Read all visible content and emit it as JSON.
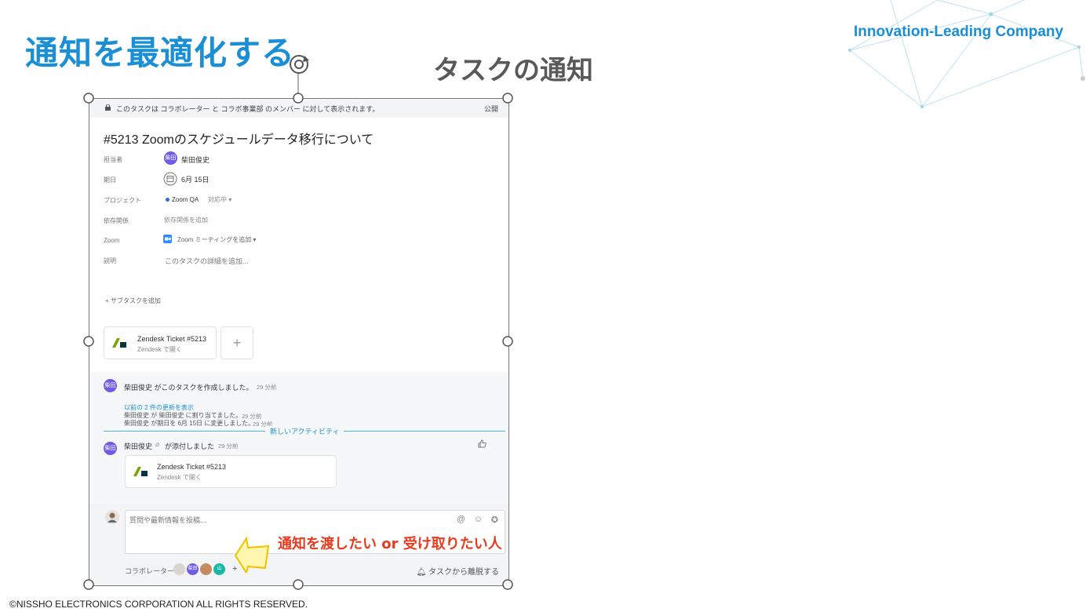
{
  "slide": {
    "title": "通知を最適化する",
    "company": "Innovation-Leading Company",
    "section": "タスクの通知",
    "copyright": "©NISSHO ELECTRONICS CORPORATION ALL RIGHTS RESERVED.",
    "accent_color": "#1a8fd6"
  },
  "task": {
    "visibility_text": "このタスクは コラボレーター と コラボ事業部 のメンバー に対して表示されます。",
    "visibility_badge": "公開",
    "title": "#5213 Zoomのスケジュールデータ移行について",
    "fields": {
      "assignee_label": "担当者",
      "assignee_avatar": "柴田",
      "assignee_name": "柴田俊史",
      "due_label": "期日",
      "due_value": "6月 15日",
      "project_label": "プロジェクト",
      "project_name": "Zoom QA",
      "project_status": "対応中 ▾",
      "dependency_label": "依存関係",
      "dependency_value": "依存関係を追加",
      "zoom_label": "Zoom",
      "zoom_value": "Zoom ミーティングを追加 ▾",
      "description_label": "説明",
      "description_placeholder": "このタスクの詳細を追加..."
    },
    "add_subtask": "+ サブタスクを追加",
    "attachment": {
      "title": "Zendesk Ticket #5213",
      "subtitle": "Zendesk で開く"
    },
    "add_attachment": "+"
  },
  "activity": {
    "created_text": "柴田俊史 がこのタスクを作成しました。",
    "created_time": "29 分前",
    "show_more": "以前の 2 件の更新を表示",
    "update1": "柴田俊史 が 柴田俊史 に割り当てました。",
    "update1_time": "29 分前",
    "update2": "柴田俊史 が期日を 6月 15日 に変更しました。",
    "update2_time": "29 分前",
    "new_activity_label": "新しいアクティビティ",
    "attached_name": "柴田俊史",
    "attached_action": "が添付しました",
    "attached_time": "29 分前",
    "attach_card_title": "Zendesk Ticket #5213",
    "attach_card_subtitle": "Zendesk で開く"
  },
  "composer": {
    "placeholder": "質問や最新情報を投稿...",
    "collaborators_label": "コラボレーター",
    "add_collaborator": "+",
    "collaborator_avatar_1": "柴田",
    "collaborator_avatar_2": "山",
    "leave_task": "タスクから離脱する"
  },
  "annotation": {
    "text": "通知を渡したい or 受け取りたい人",
    "color": "#e83a1e"
  }
}
